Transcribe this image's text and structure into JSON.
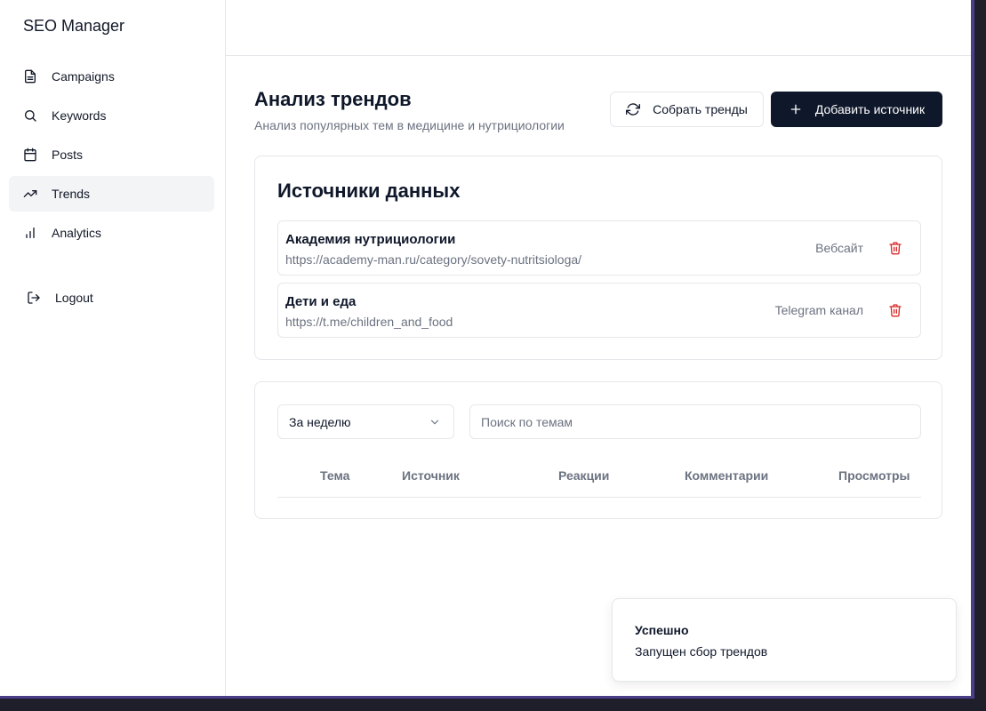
{
  "app": {
    "brand": "SEO Manager"
  },
  "sidebar": {
    "items": [
      {
        "label": "Campaigns",
        "icon": "document-icon",
        "active": false
      },
      {
        "label": "Keywords",
        "icon": "search-icon",
        "active": false
      },
      {
        "label": "Posts",
        "icon": "calendar-icon",
        "active": false
      },
      {
        "label": "Trends",
        "icon": "trending-up-icon",
        "active": true
      },
      {
        "label": "Analytics",
        "icon": "bar-chart-icon",
        "active": false
      }
    ],
    "logout_label": "Logout"
  },
  "header": {
    "title": "Анализ трендов",
    "subtitle": "Анализ популярных тем в медицине и нутрициологии"
  },
  "actions": {
    "collect_label": "Собрать тренды",
    "add_source_label": "Добавить источник"
  },
  "sources": {
    "title": "Источники данных",
    "items": [
      {
        "name": "Академия нутрициологии",
        "url": "https://academy-man.ru/category/sovety-nutritsiologa/",
        "type": "Вебсайт"
      },
      {
        "name": "Дети и еда",
        "url": "https://t.me/children_and_food",
        "type": "Telegram канал"
      }
    ]
  },
  "filters": {
    "period_value": "За неделю",
    "search_placeholder": "Поиск по темам"
  },
  "table": {
    "columns": [
      "Тема",
      "Источник",
      "Реакции",
      "Комментарии",
      "Просмотры"
    ]
  },
  "toast": {
    "title": "Успешно",
    "description": "Запущен сбор трендов"
  },
  "colors": {
    "primary": "#0f172a",
    "muted_text": "#6b7280",
    "border": "#e5e7eb",
    "active_nav_bg": "#f3f4f6",
    "danger": "#dc2626"
  }
}
